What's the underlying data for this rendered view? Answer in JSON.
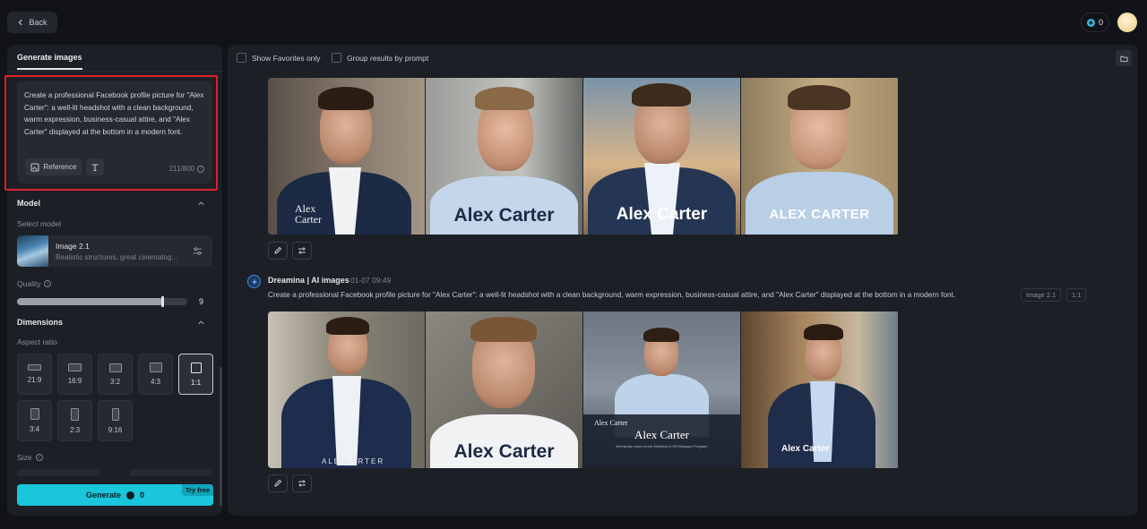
{
  "header": {
    "back_label": "Back",
    "credits": "0"
  },
  "left_panel": {
    "tab": "Generate images",
    "prompt": "Create a professional Facebook profile picture for \"Alex Carter\": a well-lit headshot with a clean background, warm expression, business-casual attire, and \"Alex Carter\" displayed at the bottom in a modern font.",
    "reference_label": "Reference",
    "char_count": "211/800",
    "model_section": "Model",
    "select_model_label": "Select model",
    "model_name": "Image 2.1",
    "model_desc": "Realistic structures, great cinematog...",
    "quality_label": "Quality",
    "quality_value": "9",
    "quality_max": 10,
    "dimensions_section": "Dimensions",
    "aspect_ratio_label": "Aspect ratio",
    "aspect_ratios": [
      "21:9",
      "16:9",
      "3:2",
      "4:3",
      "1:1",
      "3:4",
      "2:3",
      "9:16"
    ],
    "selected_aspect": "1:1",
    "size_label": "Size",
    "generate_label": "Generate",
    "generate_cost": "0",
    "try_free": "Try free"
  },
  "main": {
    "show_favorites": "Show Favorites only",
    "group_by_prompt": "Group results by prompt",
    "batch1": {
      "captions": [
        "Alex\nCarter",
        "Alex Carter",
        "Alex Carter",
        "ALEX CARTER"
      ]
    },
    "batch2": {
      "author": "Dreamina | AI images",
      "time": "01-07  09:49",
      "prompt": "Create a professional Facebook profile picture for \"Alex Carter\": a well-lit headshot with a clean background, warm expression, business-casual attire, and \"Alex Carter\" displayed at the bottom in a modern font.",
      "model_tag": "Image 2.1",
      "ratio_tag": "1:1",
      "captions": [
        "ALE CARTER",
        "Alex Carter",
        "Alex Carter",
        "Alex Carter"
      ],
      "caption_extra": "Alex Carter",
      "caption_fine": "Enterprise Lead Lorem Wellness & HR Manager Program"
    }
  },
  "colors": {
    "accent": "#19c6dc",
    "highlight": "#e0202a"
  }
}
